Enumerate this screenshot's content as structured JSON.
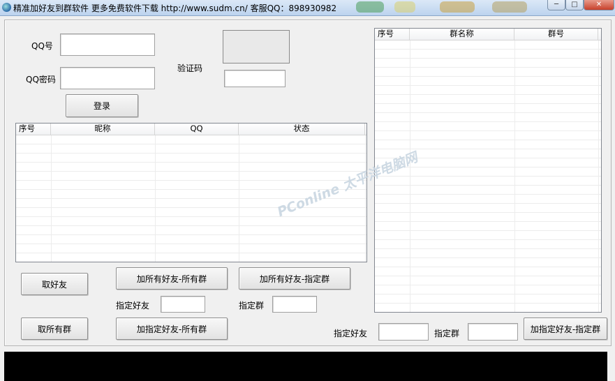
{
  "window": {
    "title": "精准加好友到群软件 更多免费软件下载 http://www.sudm.cn/ 客服QQ：898930982",
    "minimize": "─",
    "maximize": "□",
    "close": "✕"
  },
  "login": {
    "qq_label": "QQ号",
    "password_label": "QQ密码",
    "captcha_label": "验证码",
    "login_button": "登录",
    "qq_value": "",
    "password_value": "",
    "captcha_value": ""
  },
  "friends_table": {
    "columns": [
      "序号",
      "昵称",
      "QQ",
      "状态"
    ],
    "rows": []
  },
  "groups_table": {
    "columns": [
      "序号",
      "群名称",
      "群号"
    ],
    "rows": []
  },
  "actions": {
    "get_friends": "取好友",
    "get_all_groups": "取所有群",
    "add_all_friends_all_groups": "加所有好友-所有群",
    "add_all_friends_specified_group": "加所有好友-指定群",
    "add_specified_friend_all_groups": "加指定好友-所有群",
    "add_specified_friend_specified_group": "加指定好友-指定群",
    "specified_friend_label": "指定好友",
    "specified_group_label": "指定群",
    "specified_friend_value": "",
    "specified_group_value": "",
    "specified_friend_label_2": "指定好友",
    "specified_group_label_2": "指定群",
    "specified_friend_value_2": "",
    "specified_group_value_2": ""
  },
  "watermark": "PConline 太平洋电脑网"
}
